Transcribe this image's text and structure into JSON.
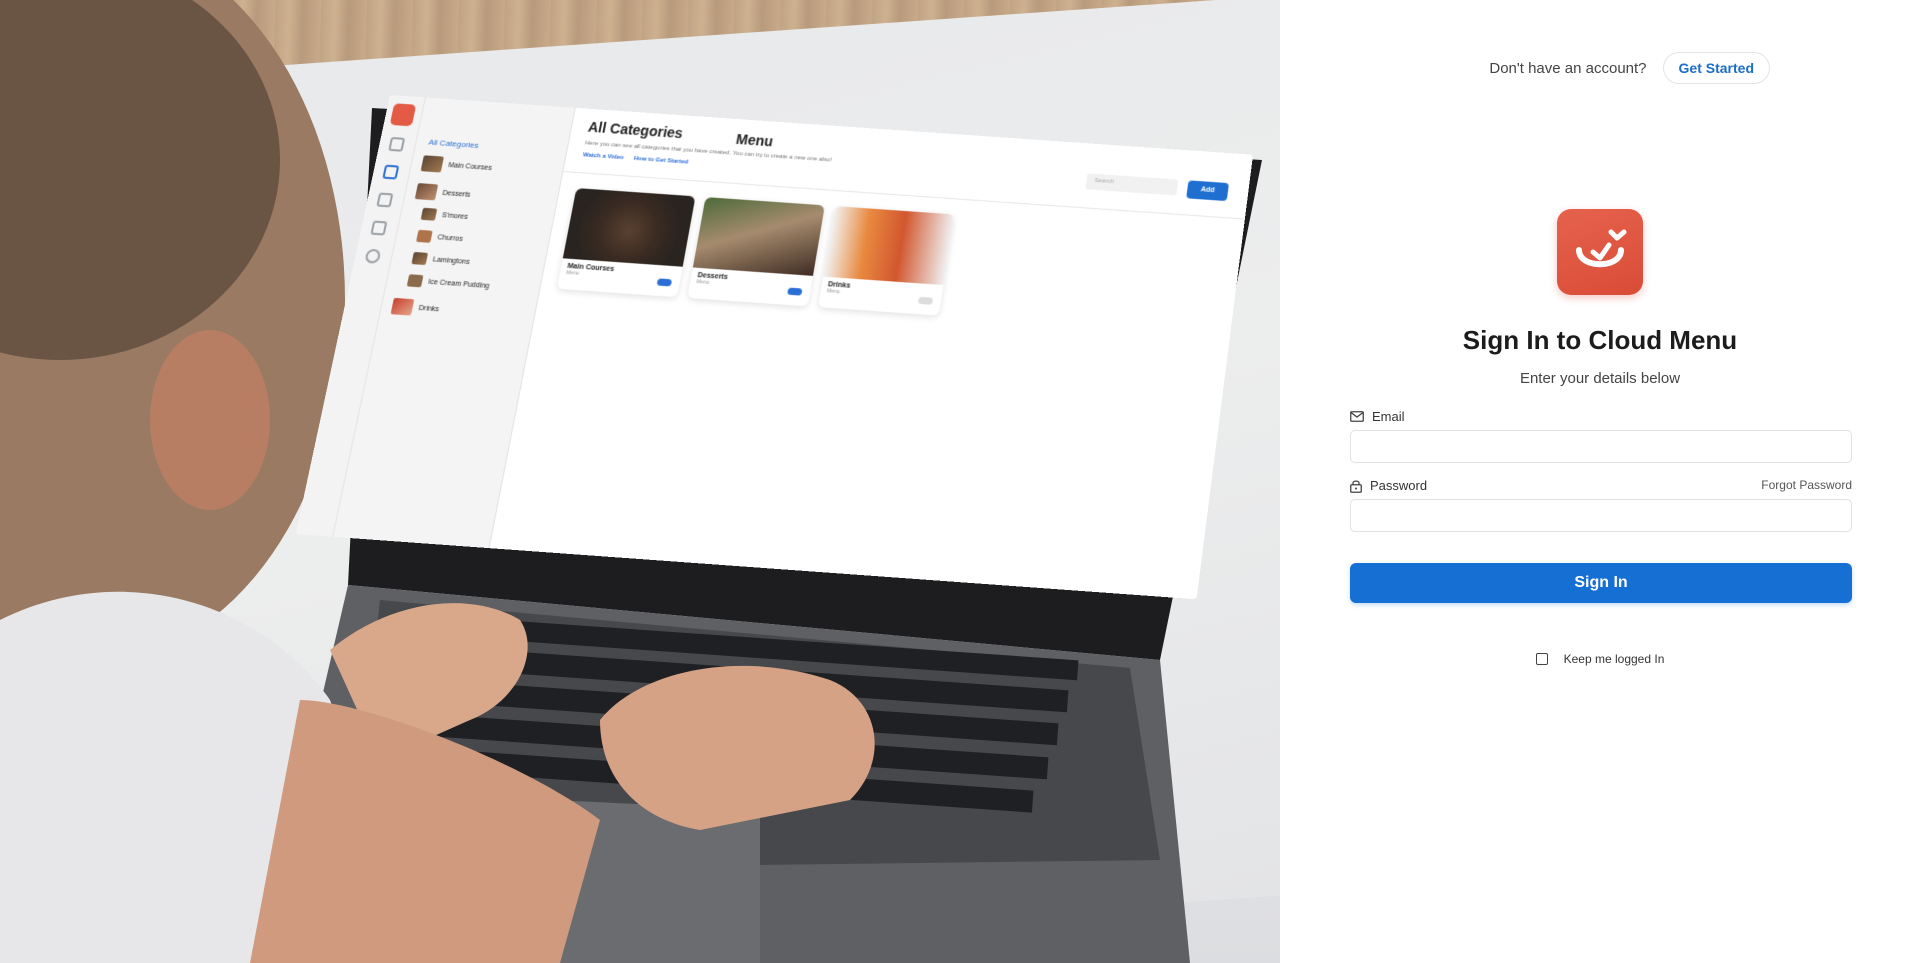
{
  "header": {
    "prompt_text": "Don't have an account?",
    "get_started_label": "Get Started"
  },
  "brand": {
    "logo_icon": "smile-icon",
    "logo_color": "#e35b45"
  },
  "form": {
    "title": "Sign In to Cloud Menu",
    "subtitle": "Enter your details below",
    "email_label": "Email",
    "email_icon": "mail-icon",
    "email_value": "",
    "password_label": "Password",
    "password_icon": "lock-icon",
    "password_value": "",
    "forgot_label": "Forgot Password",
    "submit_label": "Sign In",
    "submit_color": "#1670d4",
    "keep_logged_label": "Keep me logged In",
    "keep_logged_checked": false
  },
  "hero_screen": {
    "menu_title": "Menu",
    "all_categories": "All Categories",
    "sidebar_items": [
      "Main Courses",
      "Desserts",
      "S'mores",
      "Churros",
      "Lamingtons",
      "Ice Cream Pudding",
      "Drinks"
    ],
    "page_title": "All Categories",
    "page_subtitle": "Here you can see all categories that you have created. You can try to create a new one also!",
    "link_video": "Watch a Video",
    "link_started": "How to Get Started",
    "search_placeholder": "Search",
    "add_label": "Add",
    "cards": [
      {
        "name": "Main Courses",
        "tag": "Menu",
        "enabled": true
      },
      {
        "name": "Desserts",
        "tag": "Menu",
        "enabled": true
      },
      {
        "name": "Drinks",
        "tag": "Menu",
        "enabled": false
      }
    ]
  }
}
